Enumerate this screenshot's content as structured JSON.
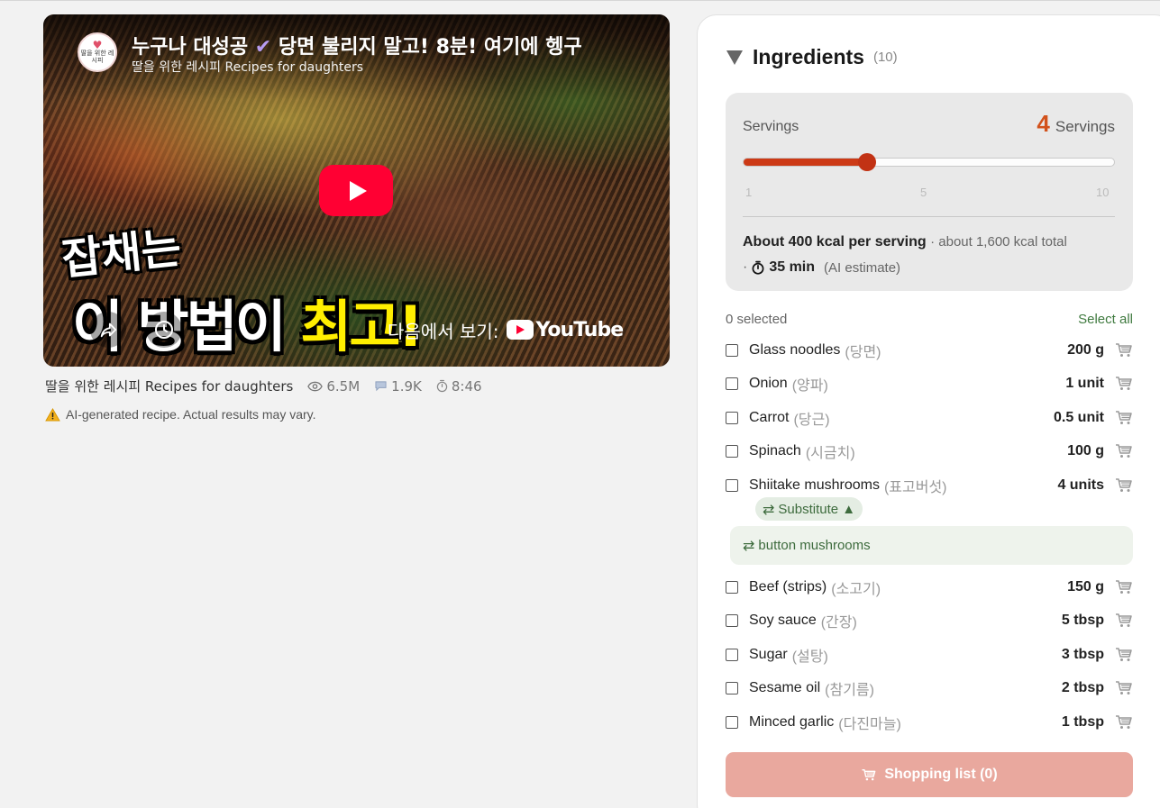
{
  "video": {
    "title": "누구나 대성공",
    "title_check": "✔",
    "title_rest": "당면 불리지 말고! 8분! 여기에 헹구",
    "channel": "딸을 위한 레시피 Recipes for daughters",
    "avatar_text": "딸을 위한 레시피",
    "overlay_top": "잡채는",
    "overlay_white": "이 방법이 ",
    "overlay_yellow": "최고!",
    "watch_on": "다음에서 보기:",
    "youtube_wordmark": "YouTube",
    "brand_color": "#ff0033"
  },
  "meta": {
    "channel": "딸을 위한 레시피 Recipes for daughters",
    "views": "6.5M",
    "comments": "1.9K",
    "duration": "8:46"
  },
  "warning": "AI-generated recipe. Actual results may vary.",
  "ingredients": {
    "title": "Ingredients",
    "count": "(10)",
    "servings": {
      "label": "Servings",
      "value": "4",
      "unit": "Servings",
      "min": 1,
      "max": 10,
      "current": 4,
      "ticks": [
        "1",
        "5",
        "10"
      ],
      "accent_color": "#cc3a16"
    },
    "kcal_per_serving": "About 400 kcal per serving",
    "kcal_total": "· about 1,600 kcal total",
    "time_prefix": "·",
    "time": "35 min",
    "time_note": "(AI estimate)",
    "selected": "0 selected",
    "select_all": "Select all",
    "items": [
      {
        "name": "Glass noodles",
        "ko": "(당면)",
        "amount": "200 g"
      },
      {
        "name": "Onion",
        "ko": "(양파)",
        "amount": "1 unit"
      },
      {
        "name": "Carrot",
        "ko": "(당근)",
        "amount": "0.5 unit"
      },
      {
        "name": "Spinach",
        "ko": "(시금치)",
        "amount": "100 g"
      },
      {
        "name": "Shiitake mushrooms",
        "ko": "(표고버섯)",
        "amount": "4 units"
      },
      {
        "name": "Beef (strips)",
        "ko": "(소고기)",
        "amount": "150 g"
      },
      {
        "name": "Soy sauce",
        "ko": "(간장)",
        "amount": "5 tbsp"
      },
      {
        "name": "Sugar",
        "ko": "(설탕)",
        "amount": "3 tbsp"
      },
      {
        "name": "Sesame oil",
        "ko": "(참기름)",
        "amount": "2 tbsp"
      },
      {
        "name": "Minced garlic",
        "ko": "(다진마늘)",
        "amount": "1 tbsp"
      }
    ],
    "substitute_label": "Substitute ▲",
    "substitute_value": "button mushrooms",
    "shopping_list": "Shopping list (0)"
  }
}
